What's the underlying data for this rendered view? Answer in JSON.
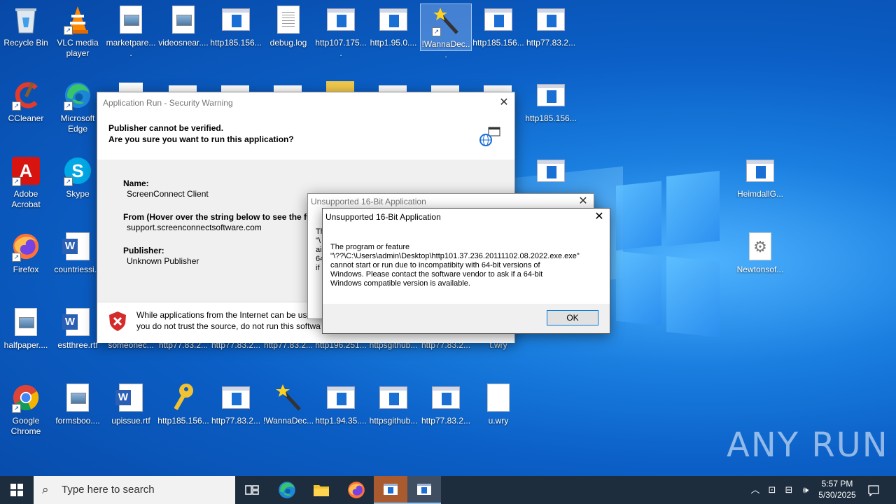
{
  "desktop": {
    "icons": [
      {
        "label": "Recycle Bin",
        "kind": "recycle"
      },
      {
        "label": "VLC media player",
        "kind": "vlc"
      },
      {
        "label": "marketpare....",
        "kind": "pic"
      },
      {
        "label": "videosnear....",
        "kind": "pic"
      },
      {
        "label": "http185.156...",
        "kind": "exe"
      },
      {
        "label": "debug.log",
        "kind": "txt"
      },
      {
        "label": "http107.175....",
        "kind": "exe"
      },
      {
        "label": "http1.95.0....",
        "kind": "exe"
      },
      {
        "label": "!WannaDec...",
        "kind": "wand"
      },
      {
        "label": "http185.156...",
        "kind": "exe"
      },
      {
        "label": "http77.83.2...",
        "kind": "exe"
      },
      {
        "label": "CCleaner",
        "kind": "ccleaner"
      },
      {
        "label": "Microsoft Edge",
        "kind": "edge"
      },
      {
        "label": "http185.156...",
        "kind": "exe"
      },
      {
        "label": "Adobe Acrobat",
        "kind": "acrobat"
      },
      {
        "label": "Skype",
        "kind": "skype"
      },
      {
        "label": "HeimdallG...",
        "kind": "exe"
      },
      {
        "label": "Firefox",
        "kind": "firefox"
      },
      {
        "label": "countriessi...",
        "kind": "word"
      },
      {
        "label": "Newtonsof...",
        "kind": "gear"
      },
      {
        "label": "halfpaper....",
        "kind": "pic"
      },
      {
        "label": "estthree.rtf",
        "kind": "word"
      },
      {
        "label": "someonec...",
        "kind": "none"
      },
      {
        "label": "http77.83.2...",
        "kind": "none"
      },
      {
        "label": "http77.83.2...",
        "kind": "none"
      },
      {
        "label": "http77.83.2...",
        "kind": "none"
      },
      {
        "label": "http196.251...",
        "kind": "none"
      },
      {
        "label": "httpsgithub...",
        "kind": "none"
      },
      {
        "label": "http77.83.2...",
        "kind": "none"
      },
      {
        "label": "t.wry",
        "kind": "none"
      },
      {
        "label": "Google Chrome",
        "kind": "chrome"
      },
      {
        "label": "formsboo....",
        "kind": "pic"
      },
      {
        "label": "upissue.rtf",
        "kind": "word"
      },
      {
        "label": "http185.156...",
        "kind": "key"
      },
      {
        "label": "http77.83.2...",
        "kind": "exe"
      },
      {
        "label": "!WannaDec...",
        "kind": "wand"
      },
      {
        "label": "http1.94.35....",
        "kind": "exe"
      },
      {
        "label": "httpsgithub...",
        "kind": "exe"
      },
      {
        "label": "http77.83.2...",
        "kind": "exe"
      },
      {
        "label": "u.wry",
        "kind": "blank"
      }
    ],
    "watermark": "ANY RUN"
  },
  "security_dialog": {
    "title": "Application Run - Security Warning",
    "heading1": "Publisher cannot be verified.",
    "heading2": "Are you sure you want to run this application?",
    "name_label": "Name:",
    "name_value": "ScreenConnect Client",
    "from_label": "From (Hover over the string below to see the fu",
    "from_value": "support.screenconnectsoftware.com",
    "publisher_label": "Publisher:",
    "publisher_value": "Unknown Publisher",
    "warning_line1": "While applications from the Internet can be us",
    "warning_line2": "you do not trust the source, do not run this softwa"
  },
  "back_dialog": {
    "title": "Unsupported 16-Bit Application",
    "fragments": [
      "Th",
      "\"\\",
      "ai",
      "64",
      "if"
    ]
  },
  "front_dialog": {
    "title": "Unsupported 16-Bit Application",
    "message_line1": "The program or feature",
    "message_line2": "\"\\??\\C:\\Users\\admin\\Desktop\\http101.37.236.20111102.08.2022.exe.exe\"",
    "message_line3": "cannot start or run due to incompatibity with 64-bit versions of",
    "message_line4": "Windows. Please contact the software vendor to ask if a 64-bit",
    "message_line5": "Windows compatible version is available.",
    "ok_label": "OK"
  },
  "taskbar": {
    "search_placeholder": "Type here to search",
    "time": "5:57 PM",
    "date": "5/30/2025"
  },
  "colors": {
    "accent": "#0078d7",
    "taskbar": "#1d2d3d"
  }
}
